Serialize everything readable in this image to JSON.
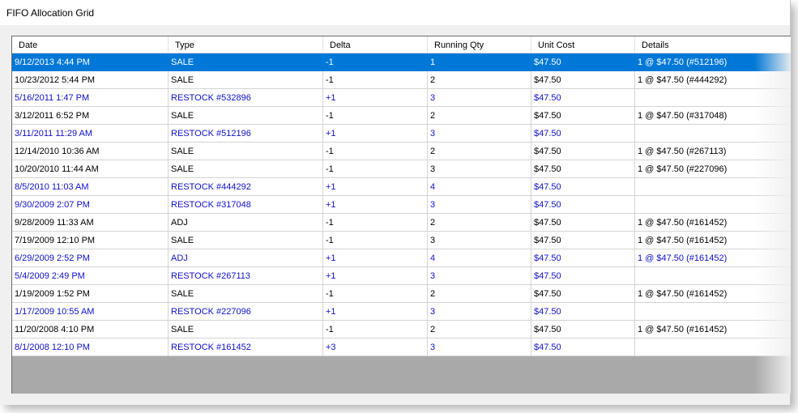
{
  "window": {
    "title": "FIFO Allocation Grid"
  },
  "columns": [
    "Date",
    "Type",
    "Delta",
    "Running Qty",
    "Unit Cost",
    "Details"
  ],
  "colors": {
    "selected": "#0078d7",
    "restock_text": "#1010d0",
    "empty_area": "#a9a9a9"
  },
  "rows": [
    {
      "date": "9/12/2013 4:44 PM",
      "type": "SALE",
      "delta": "-1",
      "qty": "1",
      "cost": "$47.50",
      "details": "1 @ $47.50 (#512196)",
      "kind": "sale",
      "selected": true
    },
    {
      "date": "10/23/2012 5:44 PM",
      "type": "SALE",
      "delta": "-1",
      "qty": "2",
      "cost": "$47.50",
      "details": "1 @ $47.50 (#444292)",
      "kind": "sale"
    },
    {
      "date": "5/16/2011 1:47 PM",
      "type": "RESTOCK #532896",
      "delta": "+1",
      "qty": "3",
      "cost": "$47.50",
      "details": "",
      "kind": "restock"
    },
    {
      "date": "3/12/2011 6:52 PM",
      "type": "SALE",
      "delta": "-1",
      "qty": "2",
      "cost": "$47.50",
      "details": "1 @ $47.50 (#317048)",
      "kind": "sale"
    },
    {
      "date": "3/11/2011 11:29 AM",
      "type": "RESTOCK #512196",
      "delta": "+1",
      "qty": "3",
      "cost": "$47.50",
      "details": "",
      "kind": "restock"
    },
    {
      "date": "12/14/2010 10:36 AM",
      "type": "SALE",
      "delta": "-1",
      "qty": "2",
      "cost": "$47.50",
      "details": "1 @ $47.50 (#267113)",
      "kind": "sale"
    },
    {
      "date": "10/20/2010 11:44 AM",
      "type": "SALE",
      "delta": "-1",
      "qty": "3",
      "cost": "$47.50",
      "details": "1 @ $47.50 (#227096)",
      "kind": "sale"
    },
    {
      "date": "8/5/2010 11:03 AM",
      "type": "RESTOCK #444292",
      "delta": "+1",
      "qty": "4",
      "cost": "$47.50",
      "details": "",
      "kind": "restock"
    },
    {
      "date": "9/30/2009 2:07 PM",
      "type": "RESTOCK #317048",
      "delta": "+1",
      "qty": "3",
      "cost": "$47.50",
      "details": "",
      "kind": "restock"
    },
    {
      "date": "9/28/2009 11:33 AM",
      "type": "ADJ",
      "delta": "-1",
      "qty": "2",
      "cost": "$47.50",
      "details": "1 @ $47.50 (#161452)",
      "kind": "sale"
    },
    {
      "date": "7/19/2009 12:10 PM",
      "type": "SALE",
      "delta": "-1",
      "qty": "3",
      "cost": "$47.50",
      "details": "1 @ $47.50 (#161452)",
      "kind": "sale"
    },
    {
      "date": "6/29/2009 2:52 PM",
      "type": "ADJ",
      "delta": "+1",
      "qty": "4",
      "cost": "$47.50",
      "details": "1 @ $47.50 (#161452)",
      "kind": "restock"
    },
    {
      "date": "5/4/2009 2:49 PM",
      "type": "RESTOCK #267113",
      "delta": "+1",
      "qty": "3",
      "cost": "$47.50",
      "details": "",
      "kind": "restock"
    },
    {
      "date": "1/19/2009 1:52 PM",
      "type": "SALE",
      "delta": "-1",
      "qty": "2",
      "cost": "$47.50",
      "details": "1 @ $47.50 (#161452)",
      "kind": "sale"
    },
    {
      "date": "1/17/2009 10:55 AM",
      "type": "RESTOCK #227096",
      "delta": "+1",
      "qty": "3",
      "cost": "$47.50",
      "details": "",
      "kind": "restock"
    },
    {
      "date": "11/20/2008 4:10 PM",
      "type": "SALE",
      "delta": "-1",
      "qty": "2",
      "cost": "$47.50",
      "details": "1 @ $47.50 (#161452)",
      "kind": "sale"
    },
    {
      "date": "8/1/2008 12:10 PM",
      "type": "RESTOCK #161452",
      "delta": "+3",
      "qty": "3",
      "cost": "$47.50",
      "details": "",
      "kind": "restock"
    }
  ]
}
